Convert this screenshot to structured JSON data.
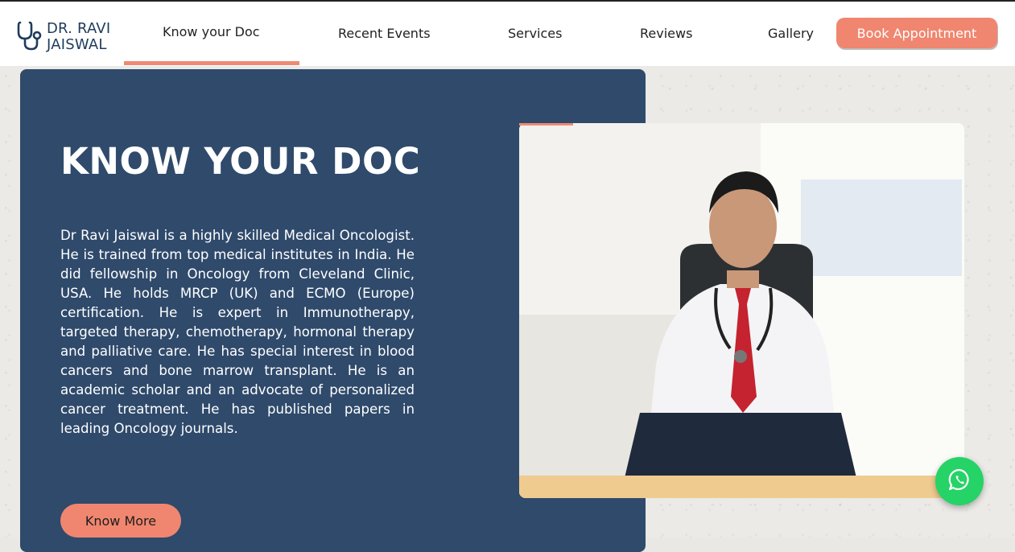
{
  "brand": {
    "line1": "DR. RAVI",
    "line2": "JAISWAL"
  },
  "nav": {
    "items": [
      {
        "label": "Know your Doc",
        "active": true
      },
      {
        "label": "Recent Events"
      },
      {
        "label": "Services"
      },
      {
        "label": "Reviews"
      },
      {
        "label": "Gallery"
      }
    ],
    "cta": "Book Appointment"
  },
  "about": {
    "heading": "KNOW YOUR DOC",
    "bio": "Dr Ravi Jaiswal is a highly skilled Medical Oncologist. He is trained from top medical institutes in India. He did fellowship in Oncology from Cleveland Clinic, USA. He holds MRCP (UK) and ECMO (Europe) certification. He is expert in Immunotherapy, targeted therapy, chemotherapy, hormonal therapy and palliative care. He has special interest in blood cancers and bone marrow transplant. He is an academic scholar and an advocate of personalized cancer treatment. He has published papers in leading Oncology journals.",
    "button": "Know More"
  },
  "icons": {
    "logo": "stethoscope-icon",
    "chat": "whatsapp-icon"
  },
  "colors": {
    "accent": "#f0866f",
    "card": "#2f4a6b",
    "brand_text": "#1f3b5c",
    "whatsapp": "#25d366"
  }
}
